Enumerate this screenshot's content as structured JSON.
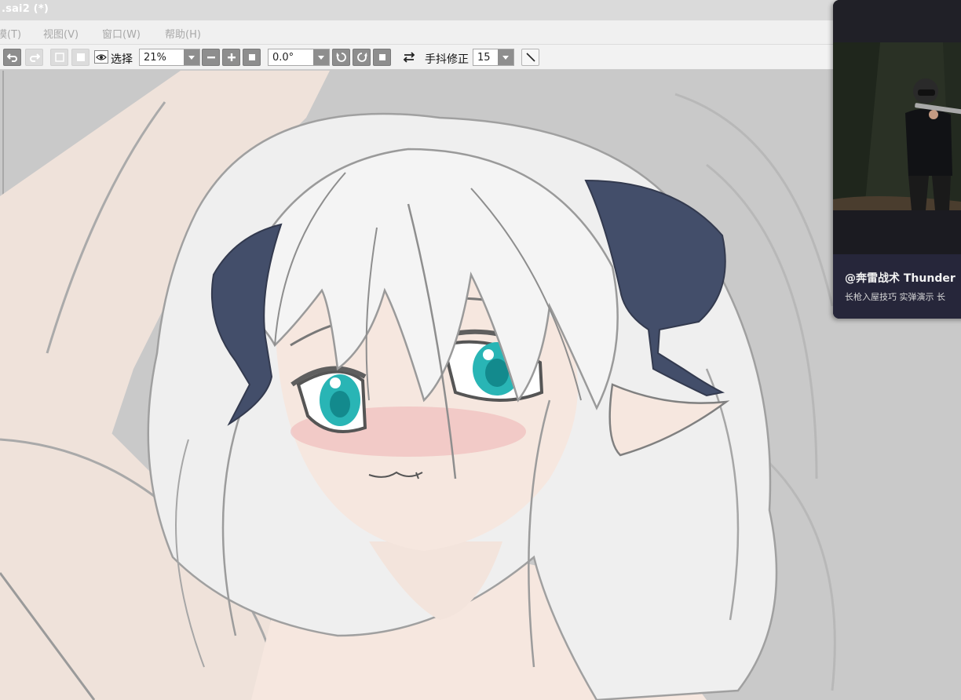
{
  "window": {
    "title": ".sai2 (*)"
  },
  "menu": {
    "items": [
      {
        "label": "模(T)"
      },
      {
        "label": "视图(V)"
      },
      {
        "label": "窗口(W)"
      },
      {
        "label": "帮助(H)"
      }
    ]
  },
  "toolbar": {
    "selection_label": "选择",
    "zoom_value": "21%",
    "rotation_value": "0.0°",
    "stabilizer_label": "手抖修正",
    "stabilizer_value": "15"
  },
  "popup": {
    "author": "@奔雷战术 Thunder",
    "description": "长枪入屋技巧 实弹演示 长"
  },
  "colors": {
    "canvas_bg": "#c9c9c9",
    "skin": "#f6e7df",
    "hair": "#f3f3f3",
    "horn": "#434e6a",
    "eye": "#29b5b5",
    "blush": "#eeb2b2",
    "popup_bg": "#1d1d24"
  }
}
